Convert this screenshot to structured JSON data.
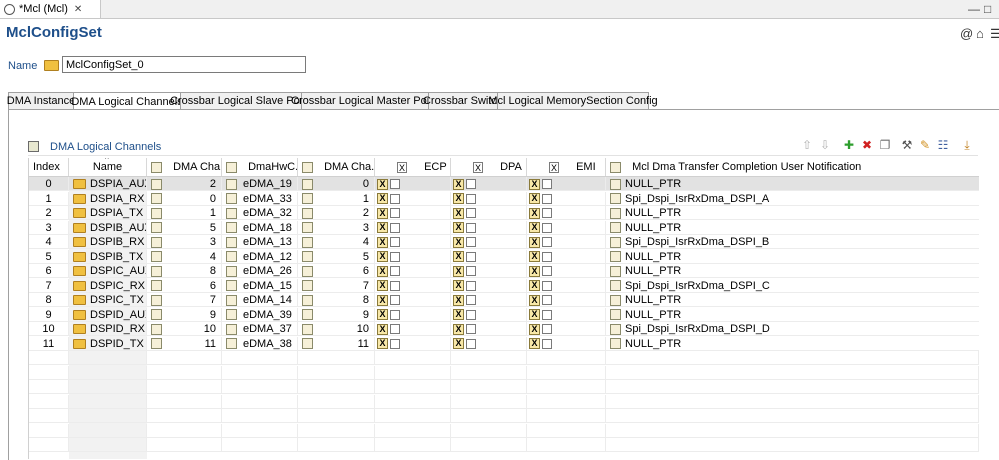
{
  "editor_tab": {
    "label": "*Mcl (Mcl)",
    "close_glyph": "✕"
  },
  "window_buttons": {
    "minimize": "—",
    "maximize": "□"
  },
  "form": {
    "title": "MclConfigSet",
    "name_label": "Name",
    "name_value": "MclConfigSet_0"
  },
  "title_icons": [
    "at-icon",
    "home-icon",
    "menu-icon"
  ],
  "config_tabs": [
    "DMA Instance",
    "DMA Logical Channels",
    "Crossbar Logical Slave Ports",
    "Crossbar Logical Master Ports",
    "Crossbar Switch",
    "Mcl Logical MemorySection Config"
  ],
  "active_tab_index": 1,
  "section": {
    "title": "DMA Logical Channels"
  },
  "toolbar": [
    {
      "icon": "move-up-icon",
      "glyph": "⇧",
      "color": "#b0b0b0"
    },
    {
      "icon": "move-down-icon",
      "glyph": "⇩",
      "color": "#b0b0b0"
    },
    {
      "icon": "add-icon",
      "glyph": "✚",
      "color": "#2e9e2e"
    },
    {
      "icon": "delete-icon",
      "glyph": "✖",
      "color": "#d02020"
    },
    {
      "icon": "copy-icon",
      "glyph": "❐",
      "color": "#707070"
    },
    {
      "icon": "find-icon",
      "glyph": "⚒",
      "color": "#505050"
    },
    {
      "icon": "edit-icon",
      "glyph": "✎",
      "color": "#d09020"
    },
    {
      "icon": "edit-table-icon",
      "glyph": "☷",
      "color": "#4060a0"
    },
    {
      "icon": "export-icon",
      "glyph": "⤓",
      "color": "#c08020"
    }
  ],
  "columns": {
    "index": "Index",
    "name": "Name",
    "sort_glyph": "^",
    "dma_channel": "DMA Cha...",
    "dma_hw_channel": "DmaHwC...",
    "dma_channel_2": "DMA Cha...",
    "ecp": "ECP",
    "dpa": "DPA",
    "emi": "EMI",
    "notification": "Mcl Dma Transfer Completion User Notification",
    "x_glyph": "X"
  },
  "rows": [
    {
      "index": "0",
      "name": "DSPIA_AUX",
      "dma_channel": "2",
      "hw": "eDMA_19",
      "dma_channel_2": "0",
      "notify": "NULL_PTR"
    },
    {
      "index": "1",
      "name": "DSPIA_RX",
      "dma_channel": "0",
      "hw": "eDMA_33",
      "dma_channel_2": "1",
      "notify": "Spi_Dspi_IsrRxDma_DSPI_A"
    },
    {
      "index": "2",
      "name": "DSPIA_TX",
      "dma_channel": "1",
      "hw": "eDMA_32",
      "dma_channel_2": "2",
      "notify": "NULL_PTR"
    },
    {
      "index": "3",
      "name": "DSPIB_AUX",
      "dma_channel": "5",
      "hw": "eDMA_18",
      "dma_channel_2": "3",
      "notify": "NULL_PTR"
    },
    {
      "index": "4",
      "name": "DSPIB_RX",
      "dma_channel": "3",
      "hw": "eDMA_13",
      "dma_channel_2": "4",
      "notify": "Spi_Dspi_IsrRxDma_DSPI_B"
    },
    {
      "index": "5",
      "name": "DSPIB_TX",
      "dma_channel": "4",
      "hw": "eDMA_12",
      "dma_channel_2": "5",
      "notify": "NULL_PTR"
    },
    {
      "index": "6",
      "name": "DSPIC_AUX",
      "dma_channel": "8",
      "hw": "eDMA_26",
      "dma_channel_2": "6",
      "notify": "NULL_PTR"
    },
    {
      "index": "7",
      "name": "DSPIC_RX",
      "dma_channel": "6",
      "hw": "eDMA_15",
      "dma_channel_2": "7",
      "notify": "Spi_Dspi_IsrRxDma_DSPI_C"
    },
    {
      "index": "8",
      "name": "DSPIC_TX",
      "dma_channel": "7",
      "hw": "eDMA_14",
      "dma_channel_2": "8",
      "notify": "NULL_PTR"
    },
    {
      "index": "9",
      "name": "DSPID_AUX",
      "dma_channel": "9",
      "hw": "eDMA_39",
      "dma_channel_2": "9",
      "notify": "NULL_PTR"
    },
    {
      "index": "10",
      "name": "DSPID_RX",
      "dma_channel": "10",
      "hw": "eDMA_37",
      "dma_channel_2": "10",
      "notify": "Spi_Dspi_IsrRxDma_DSPI_D"
    },
    {
      "index": "11",
      "name": "DSPID_TX",
      "dma_channel": "11",
      "hw": "eDMA_38",
      "dma_channel_2": "11",
      "notify": "NULL_PTR"
    }
  ],
  "selected_row": 0
}
